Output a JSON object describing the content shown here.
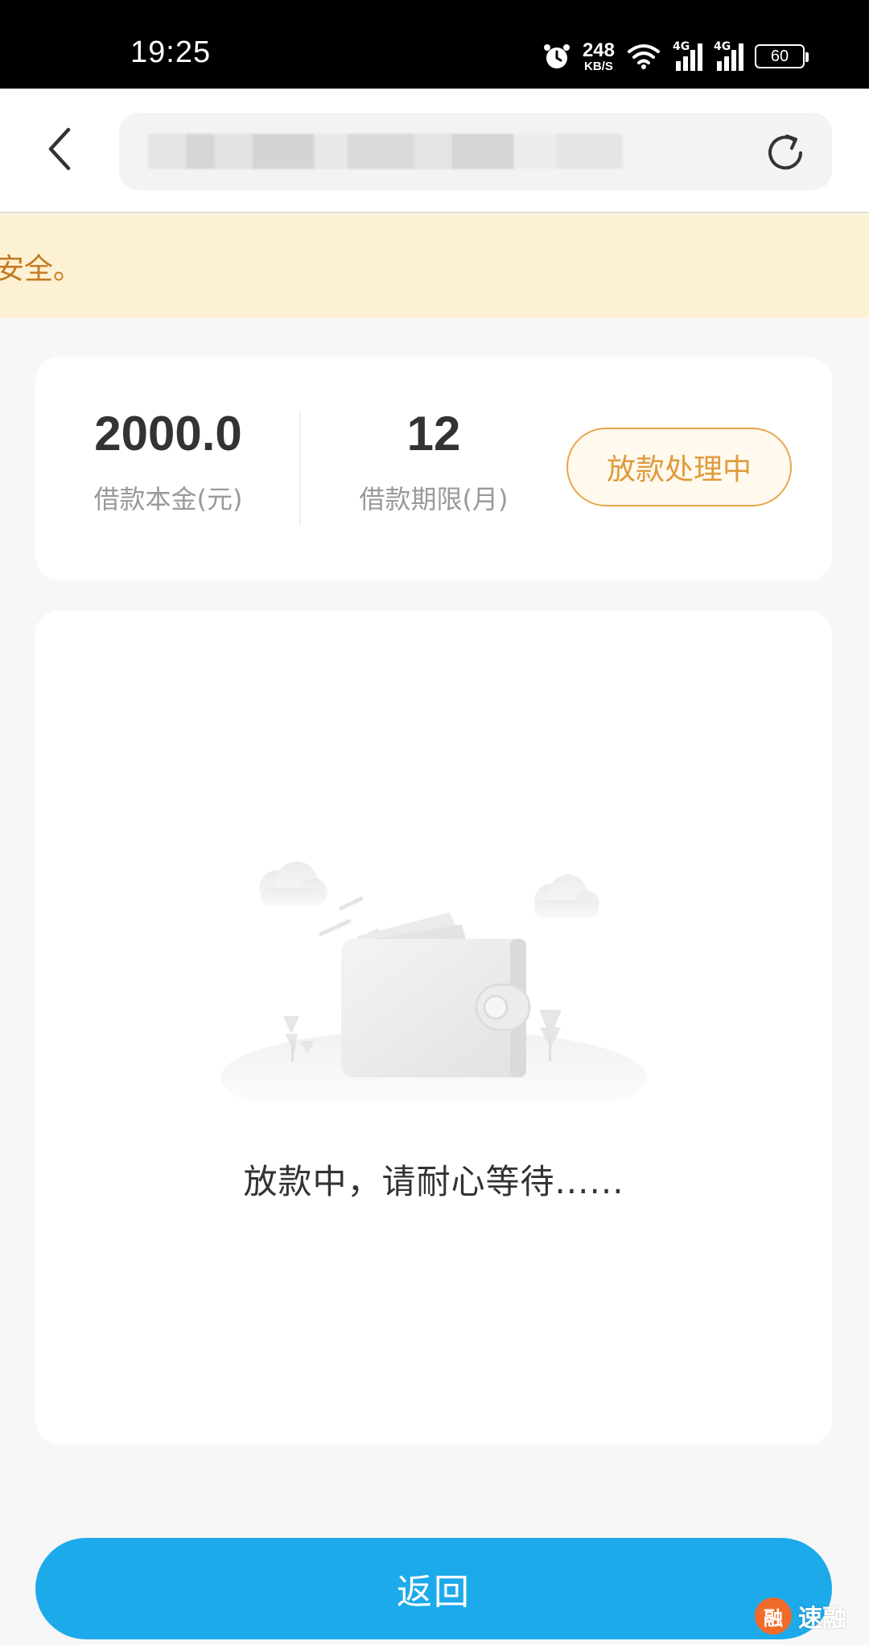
{
  "status_bar": {
    "time": "19:25",
    "net_speed": "248",
    "net_speed_unit": "KB/S",
    "signal_1_label": "4G",
    "signal_2_label": "4G",
    "battery": "60"
  },
  "nav": {
    "url": ""
  },
  "notice": {
    "text": "安全。"
  },
  "loan": {
    "principal_value": "2000.0",
    "principal_label": "借款本金(元)",
    "term_value": "12",
    "term_label": "借款期限(月)",
    "status": "放款处理中"
  },
  "content": {
    "wait_text": "放款中，请耐心等待......"
  },
  "actions": {
    "return_label": "返回"
  },
  "watermark": {
    "logo_char": "融",
    "text": "速融"
  },
  "colors": {
    "primary": "#1daaea",
    "status_orange": "#e09a3c",
    "notice_bg": "#fdf1d3",
    "notice_text": "#c47a20"
  }
}
